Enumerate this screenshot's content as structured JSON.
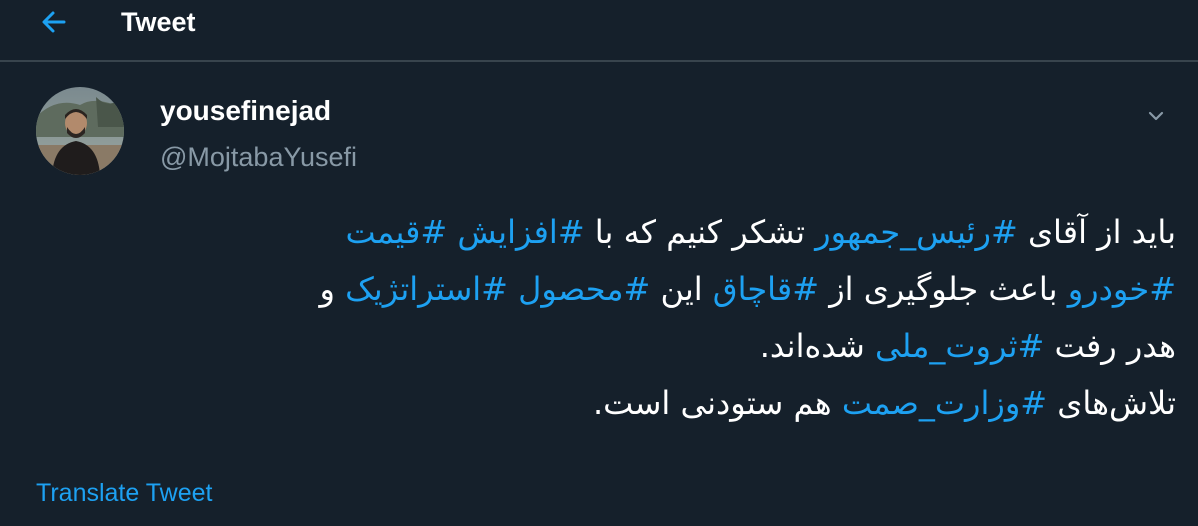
{
  "header": {
    "title": "Tweet",
    "back_icon": "arrow-left-icon"
  },
  "colors": {
    "background": "#15202b",
    "accent": "#1da1f2",
    "muted": "#8899a6",
    "divider": "#38444d"
  },
  "tweet": {
    "display_name": "yousefinejad",
    "handle": "@MojtabaYusefi",
    "caret_icon": "chevron-down-icon",
    "body": {
      "line1": [
        {
          "text": "باید از آقای ",
          "tag": false
        },
        {
          "text": "#رئیس_جمهور",
          "tag": true
        },
        {
          "text": " تشکر کنیم که با ",
          "tag": false
        },
        {
          "text": "#افزایش",
          "tag": true
        },
        {
          "text": " ",
          "tag": false
        },
        {
          "text": "#قیمت",
          "tag": true
        }
      ],
      "line2": [
        {
          "text": "#خودرو",
          "tag": true
        },
        {
          "text": " باعث جلوگیری از  ",
          "tag": false
        },
        {
          "text": "#قاچاق",
          "tag": true
        },
        {
          "text": " این ",
          "tag": false
        },
        {
          "text": "#محصول",
          "tag": true
        },
        {
          "text": " ",
          "tag": false
        },
        {
          "text": "#استراتژیک",
          "tag": true
        },
        {
          "text": " و",
          "tag": false
        }
      ],
      "line3": [
        {
          "text": "هدر رفت ",
          "tag": false
        },
        {
          "text": "#ثروت_ملی",
          "tag": true
        },
        {
          "text": " شده‌اند.",
          "tag": false
        }
      ],
      "line4": [
        {
          "text": "تلاش‌های ",
          "tag": false
        },
        {
          "text": "#وزارت_صمت",
          "tag": true
        },
        {
          "text": " هم ستودنی است.",
          "tag": false
        }
      ]
    },
    "translate_label": "Translate Tweet"
  }
}
